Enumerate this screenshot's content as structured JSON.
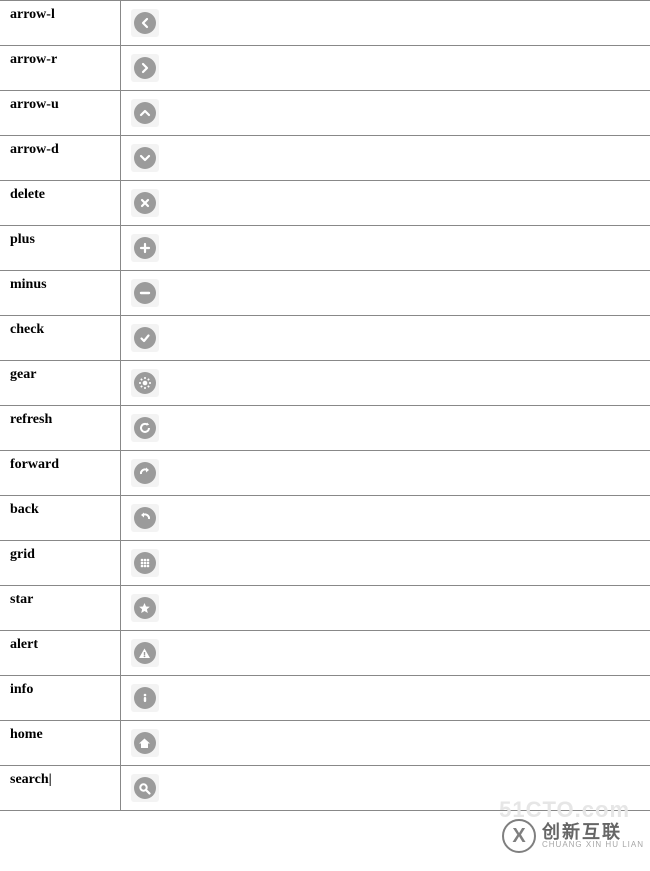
{
  "rows": [
    {
      "name": "arrow-l",
      "icon": "arrow-left-icon"
    },
    {
      "name": "arrow-r",
      "icon": "arrow-right-icon"
    },
    {
      "name": "arrow-u",
      "icon": "arrow-up-icon"
    },
    {
      "name": "arrow-d",
      "icon": "arrow-down-icon"
    },
    {
      "name": "delete",
      "icon": "delete-icon"
    },
    {
      "name": "plus",
      "icon": "plus-icon"
    },
    {
      "name": "minus",
      "icon": "minus-icon"
    },
    {
      "name": "check",
      "icon": "check-icon"
    },
    {
      "name": "gear",
      "icon": "gear-icon"
    },
    {
      "name": "refresh",
      "icon": "refresh-icon"
    },
    {
      "name": "forward",
      "icon": "forward-icon"
    },
    {
      "name": "back",
      "icon": "back-icon"
    },
    {
      "name": "grid",
      "icon": "grid-icon"
    },
    {
      "name": "star",
      "icon": "star-icon"
    },
    {
      "name": "alert",
      "icon": "alert-icon"
    },
    {
      "name": "info",
      "icon": "info-icon"
    },
    {
      "name": "home",
      "icon": "home-icon"
    },
    {
      "name": "search|",
      "icon": "search-icon"
    }
  ],
  "watermark": {
    "ghost": "51CTO.com",
    "brand": "创新互联",
    "sub": "CHUANG XIN HU LIAN",
    "logo": "X"
  }
}
